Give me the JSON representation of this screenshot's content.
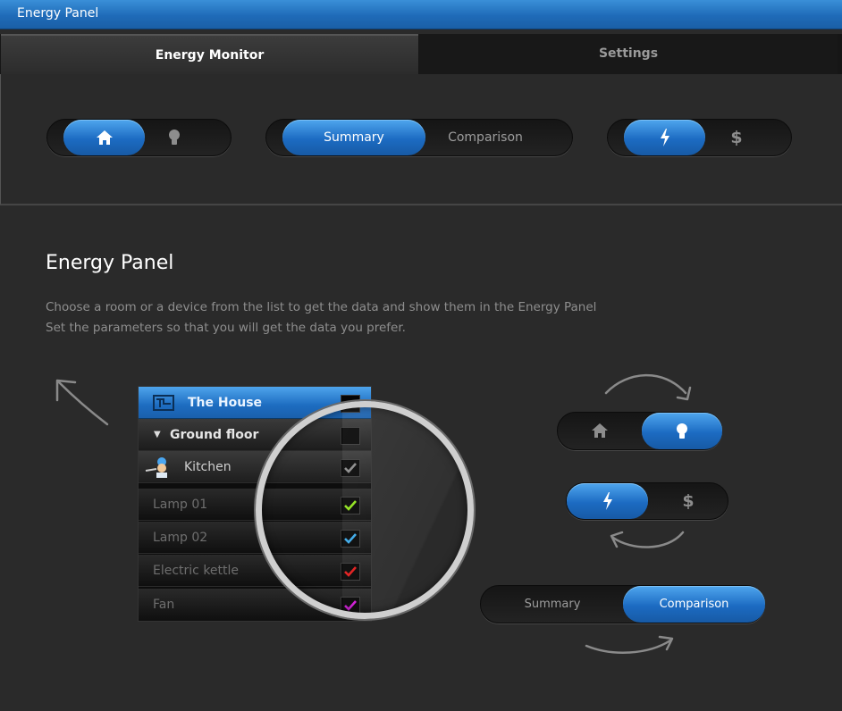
{
  "window": {
    "title": "Energy Panel"
  },
  "tabs": [
    {
      "label": "Energy Monitor",
      "active": true
    },
    {
      "label": "Settings",
      "active": false
    }
  ],
  "toolbar": {
    "location_toggle": {
      "options": [
        "home-icon",
        "bulb-icon"
      ],
      "selected": "home-icon"
    },
    "view_toggle": {
      "options": [
        "Summary",
        "Comparison"
      ],
      "selected": "Summary"
    },
    "unit_toggle": {
      "options": [
        "bolt-icon",
        "$"
      ],
      "selected": "bolt-icon"
    }
  },
  "help": {
    "title": "Energy Panel",
    "line1": "Choose a room or a device from the list to get the data and show them in the Energy Panel",
    "line2": "Set the parameters so that you will get the data you prefer.",
    "list": {
      "rows": [
        {
          "label": "The House",
          "checked": false
        },
        {
          "label": "Ground floor",
          "checked": false
        },
        {
          "label": "Kitchen",
          "checked": true,
          "check_color": "#8a8a8a"
        },
        {
          "label": "Lamp 01",
          "checked": true,
          "check_color": "#8fe21a"
        },
        {
          "label": "Lamp 02",
          "checked": true,
          "check_color": "#3aa8e8"
        },
        {
          "label": "Electric kettle",
          "checked": true,
          "check_color": "#e01a1a"
        },
        {
          "label": "Fan",
          "checked": true,
          "check_color": "#d21ad8"
        }
      ]
    },
    "demo_toggles": {
      "location": {
        "options": [
          "home-icon",
          "bulb-icon"
        ],
        "selected": "bulb-icon"
      },
      "unit": {
        "options": [
          "bolt-icon",
          "$"
        ],
        "selected": "bolt-icon"
      },
      "view": {
        "options": [
          "Summary",
          "Comparison"
        ],
        "selected": "Comparison"
      }
    }
  },
  "colors": {
    "accent": "#1c6bc2",
    "titlebar": "#2a7cc9",
    "background": "#2a2a2a"
  }
}
